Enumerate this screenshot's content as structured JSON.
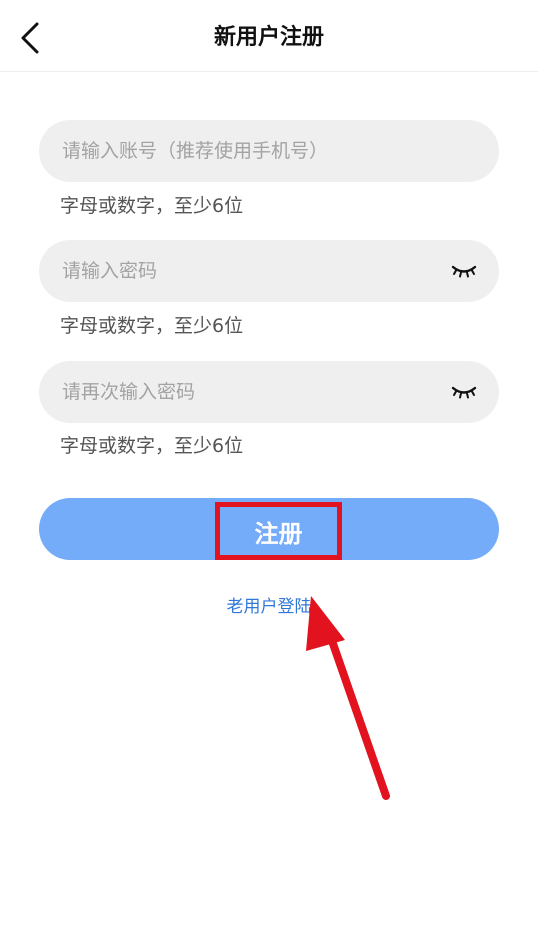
{
  "header": {
    "title": "新用户注册"
  },
  "form": {
    "account": {
      "placeholder": "请输入账号（推荐使用手机号）",
      "value": "",
      "hint": "字母或数字，至少6位"
    },
    "password": {
      "placeholder": "请输入密码",
      "value": "",
      "hint": "字母或数字，至少6位"
    },
    "confirm_password": {
      "placeholder": "请再次输入密码",
      "value": "",
      "hint": "字母或数字，至少6位"
    },
    "submit_label": "注册",
    "login_link": "老用户登陆"
  },
  "icons": {
    "back": "chevron-left-icon",
    "password_toggle": "eye-closed-icon"
  },
  "colors": {
    "button_bg": "#74acf9",
    "link": "#2f78d8",
    "field_bg": "#efefef",
    "highlight": "#e2131e"
  }
}
